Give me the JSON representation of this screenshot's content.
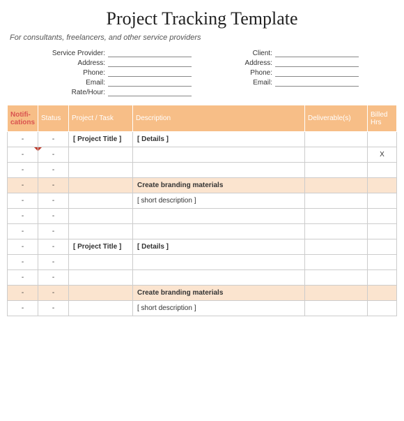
{
  "title": "Project Tracking Template",
  "subtitle": "For consultants, freelancers, and other service providers",
  "provider_fields": [
    "Service Provider:",
    "Address:",
    "Phone:",
    "Email:",
    "Rate/Hour:"
  ],
  "client_fields": [
    "Client:",
    "Address:",
    "Phone:",
    "Email:"
  ],
  "columns": {
    "notif": "Notifi-cations",
    "status": "Status",
    "project": "Project / Task",
    "desc": "Description",
    "deliv": "Deliverable(s)",
    "billed": "Billed Hrs"
  },
  "rows": [
    {
      "notif": "-",
      "status": "-",
      "project": "[ Project Title ]",
      "desc": "[ Details ]",
      "bold": true
    },
    {
      "notif": "-",
      "status": "-",
      "billed": "X",
      "marks": true
    },
    {
      "notif": "-",
      "status": "-"
    },
    {
      "notif": "-",
      "status": "-",
      "desc": "Create branding materials",
      "bold": true,
      "highlight": true
    },
    {
      "notif": "-",
      "status": "-",
      "desc": "[ short description ]"
    },
    {
      "notif": "-",
      "status": "-"
    },
    {
      "notif": "-",
      "status": "-"
    },
    {
      "notif": "-",
      "status": "-",
      "project": "[ Project Title ]",
      "desc": "[ Details ]",
      "bold": true
    },
    {
      "notif": "-",
      "status": "-"
    },
    {
      "notif": "-",
      "status": "-"
    },
    {
      "notif": "-",
      "status": "-",
      "desc": "Create branding materials",
      "bold": true,
      "highlight": true
    },
    {
      "notif": "-",
      "status": "-",
      "desc": "[ short description ]"
    }
  ]
}
